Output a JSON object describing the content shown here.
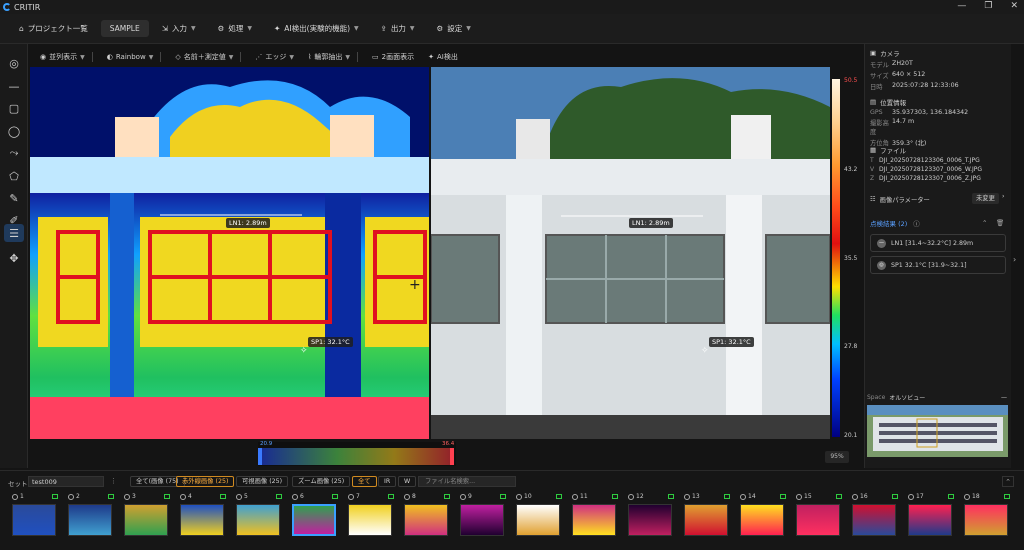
{
  "app": {
    "title": "CRITIR",
    "window_controls": [
      "—",
      "❐",
      "✕"
    ]
  },
  "menu": {
    "items": [
      {
        "label": "プロジェクト一覧",
        "icon": "home-icon"
      },
      {
        "label": "SAMPLE"
      },
      {
        "label": "入力",
        "icon": "import-icon"
      },
      {
        "label": "処理",
        "icon": "process-icon"
      },
      {
        "label": "AI検出(実験的機能)",
        "icon": "ai-icon"
      },
      {
        "label": "出力",
        "icon": "export-icon"
      },
      {
        "label": "設定",
        "icon": "gear-icon"
      }
    ]
  },
  "viewer_toolbar": {
    "items": [
      "並列表示",
      "Rainbow",
      "名前＋測定値",
      "エッジ",
      "輪郭抽出",
      "2画面表示",
      "AI検出"
    ]
  },
  "measurements": {
    "line": "LN1: 2.89m",
    "spot": "SP1: 32.1°C"
  },
  "scale": {
    "max": "50.5",
    "v2": "43.2",
    "v3": "35.5",
    "v4": "27.8",
    "min": "20.1"
  },
  "histogram": {
    "low": "20.9",
    "high": "36.4"
  },
  "zoom": "95%",
  "panel": {
    "camera": {
      "title": "カメラ",
      "model_k": "モデル",
      "model_v": "ZH20T",
      "size_k": "サイズ",
      "size_v": "640 × 512",
      "date_k": "日時",
      "date_v": "2025:07:28 12:33:06"
    },
    "location": {
      "title": "位置情報",
      "gps_k": "GPS",
      "gps_v": "35.937303, 136.184342",
      "alt_k": "撮影高度",
      "alt_v": "14.7 m",
      "dir_k": "方位角",
      "dir_v": "359.3° (北)"
    },
    "files": {
      "title": "ファイル",
      "t": "DJI_20250728123306_0006_T.JPG",
      "v": "DJI_20250728123307_0006_W.JPG",
      "z": "DJI_20250728123307_0006_Z.JPG"
    },
    "params": {
      "title": "画像パラメーター",
      "btn": "未変更"
    },
    "points": {
      "title": "点検結果 (2)",
      "ln": "LN1  [31.4~32.2°C] 2.89m",
      "sp": "SP1  32.1°C [31.9~32.1]"
    },
    "space": {
      "label": "Space",
      "view": "オルソビュー"
    }
  },
  "bottom": {
    "set_label": "セット:",
    "set_value": "test009",
    "filters": [
      "全て(画像 (75)",
      "赤外線画像 (25)",
      "可視画像 (25)",
      "ズーム画像 (25)",
      "全て",
      "IR",
      "W"
    ],
    "search_placeholder": "ファイル名検索...",
    "thumbs": [
      "1",
      "2",
      "3",
      "4",
      "5",
      "6",
      "7",
      "8",
      "9",
      "10",
      "11",
      "12",
      "13",
      "14",
      "15",
      "16",
      "17",
      "18"
    ]
  }
}
